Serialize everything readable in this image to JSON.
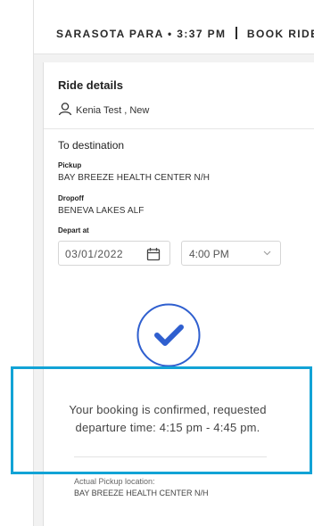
{
  "header": {
    "location": "SARASOTA PARA",
    "bullet": "•",
    "time": "3:37 PM",
    "title": "BOOK RIDE"
  },
  "ride_details": {
    "title": "Ride details",
    "rider_name": "Kenia Test , New",
    "destination_heading": "To destination",
    "pickup_label": "Pickup",
    "pickup_value": "BAY BREEZE HEALTH CENTER N/H",
    "dropoff_label": "Dropoff",
    "dropoff_value": "BENEVA LAKES ALF",
    "depart_label": "Depart at",
    "date_value": "03/01/2022",
    "time_value": "4:00 PM"
  },
  "confirmation": {
    "line1": "Your booking is confirmed, requested",
    "line2": "departure time: 4:15 pm - 4:45 pm.",
    "actual_pickup_label": "Actual Pickup location:",
    "actual_pickup_value": "BAY BREEZE HEALTH CENTER N/H"
  },
  "colors": {
    "accent": "#2f5fcf",
    "highlight": "#12a3d6"
  },
  "icons": {
    "rider": "person-icon",
    "date": "calendar-icon",
    "time": "chevron-down-icon",
    "confirm": "checkmark-circle-icon"
  }
}
